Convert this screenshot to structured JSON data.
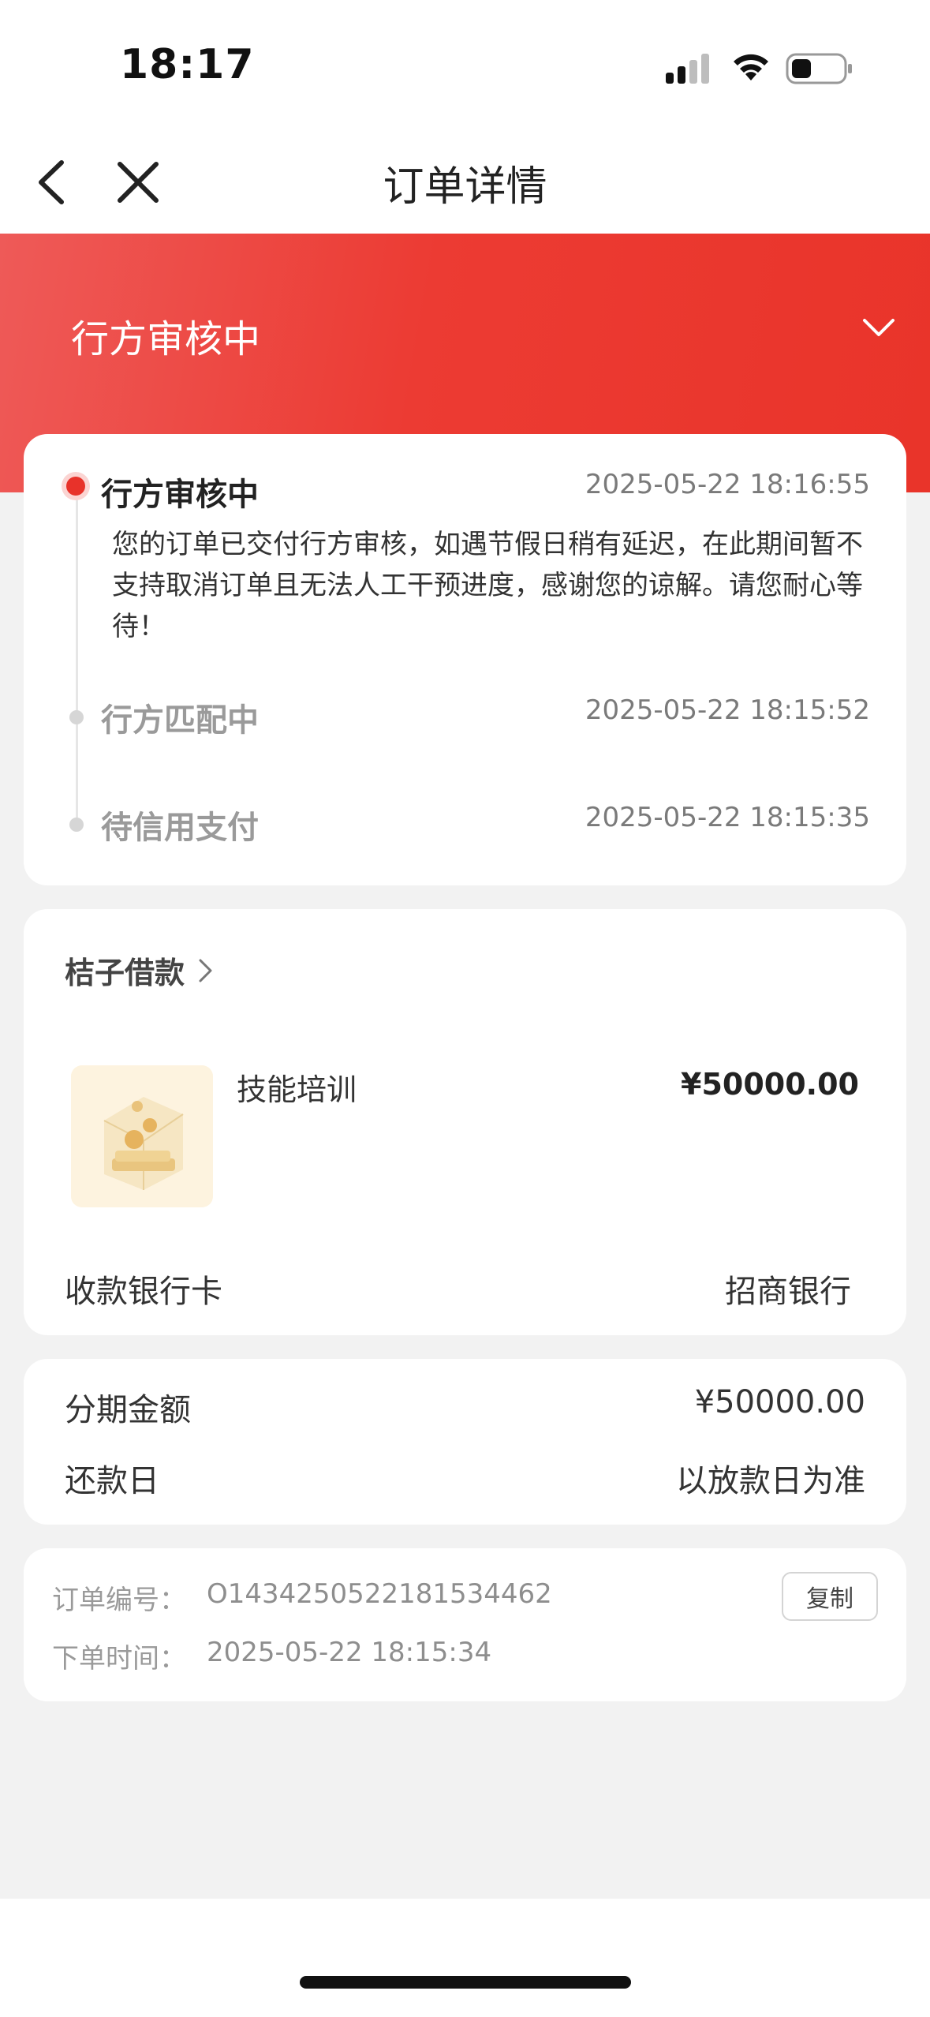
{
  "status_bar": {
    "time": "18:17"
  },
  "nav": {
    "title": "订单详情"
  },
  "header": {
    "status_title": "行方审核中"
  },
  "timeline": {
    "steps": [
      {
        "title": "行方审核中",
        "time": "2025-05-22 18:16:55",
        "desc": "您的订单已交付行方审核，如遇节假日稍有延迟，在此期间暂不支持取消订单且无法人工干预进度，感谢您的谅解。请您耐心等待！"
      },
      {
        "title": "行方匹配中",
        "time": "2025-05-22 18:15:52"
      },
      {
        "title": "待信用支付",
        "time": "2025-05-22 18:15:35"
      }
    ]
  },
  "product": {
    "merchant": "桔子借款",
    "name": "技能培训",
    "price": "¥50000.00",
    "bank_label": "收款银行卡",
    "bank_value": "招商银行"
  },
  "installment": {
    "amount_label": "分期金额",
    "amount_value": "¥50000.00",
    "repay_label": "还款日",
    "repay_value": "以放款日为准"
  },
  "order": {
    "number_label": "订单编号：",
    "number_value": "O1434250522181534462",
    "copy_label": "复制",
    "time_label": "下单时间：",
    "time_value": "2025-05-22 18:15:34"
  },
  "colors": {
    "accent": "#e8322a",
    "background": "#f2f2f2"
  }
}
